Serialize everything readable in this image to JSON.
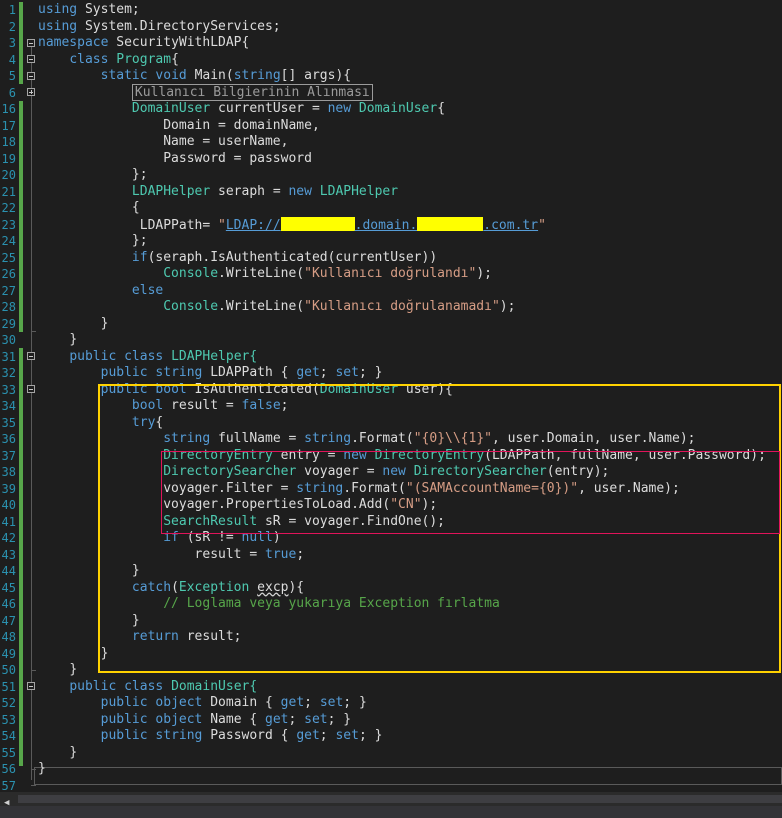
{
  "editor": {
    "line_numbers": [
      "1",
      "2",
      "3",
      "4",
      "5",
      "6",
      "16",
      "17",
      "18",
      "19",
      "20",
      "21",
      "22",
      "23",
      "24",
      "25",
      "26",
      "27",
      "28",
      "29",
      "30",
      "31",
      "32",
      "33",
      "34",
      "35",
      "36",
      "37",
      "38",
      "39",
      "40",
      "41",
      "42",
      "43",
      "44",
      "45",
      "46",
      "47",
      "48",
      "49",
      "50",
      "51",
      "52",
      "53",
      "54",
      "55",
      "56",
      "57"
    ],
    "tokens": {
      "using": "using",
      "system": "System;",
      "system_ds": "System.DirectoryServices;",
      "namespace": "namespace",
      "ns_name": "SecurityWithLDAP{",
      "class": "class",
      "program": "Program",
      "brace_open": "{",
      "static": "static",
      "void": "void",
      "main": "Main(",
      "string_kw": "string",
      "main_args": "[] args){",
      "collapsed_region": "Kullanıcı Bilgierinin Alınması",
      "domainuser": "DomainUser",
      "current_user_decl": " currentUser = ",
      "new": "new",
      "domain_assign": "Domain = domainName,",
      "name_assign": "Name = userName,",
      "password_assign": "Password = password",
      "close_semi": "};",
      "close_brace": "}",
      "ldaphelper": "LDAPHelper",
      "seraph_decl": " seraph = ",
      "ldap_path_assign": "LDAPPath= ",
      "quote": "\"",
      "ldap_url_start": "LDAP://",
      "ldap_url_mid": ".domain.",
      "ldap_url_end": ".com.tr",
      "if": "if",
      "if_cond": "(seraph.IsAuthenticated(currentUser))",
      "console": "Console",
      "writeline": ".WriteLine(",
      "msg_ok": "\"Kullanıcı doğrulandı\"",
      "paren_semi": ");",
      "else": "else",
      "msg_fail": "\"Kullanıcı doğrulanamadı\"",
      "public": "public",
      "ldaphelper_decl": "LDAPHelper{",
      "ldappath_prop": " LDAPPath { ",
      "get": "get",
      "semi_space": "; ",
      "set": "set",
      "prop_end": "; }",
      "bool": "bool",
      "is_auth": " IsAuthenticated(",
      "user_param": " user){",
      "result_decl": " result = ",
      "false": "false",
      "semi": ";",
      "try": "try",
      "fullname_decl": " fullName = ",
      "format": ".Format(",
      "fmt_domain": "\"{0}\\\\{1}\"",
      "fmt_args": ", user.Domain, user.Name);",
      "directoryentry": "DirectoryEntry",
      "entry_decl": " entry = ",
      "entry_args": "(LDAPPath, fullName, user.Password);",
      "directorysearcher": "DirectorySearcher",
      "voyager_decl": " voyager = ",
      "searcher_args": "(entry);",
      "filter_assign": "voyager.Filter = ",
      "fmt_filter": "\"(SAMAccountName={0})\"",
      "filter_args": ", user.Name);",
      "props_add": "voyager.PropertiesToLoad.Add(",
      "cn": "\"CN\"",
      "searchresult": "SearchResult",
      "sr_decl": " sR = voyager.FindOne();",
      "if_sr": " (sR != ",
      "null": "null",
      "paren_close": ")",
      "result_assign": "result = ",
      "true": "true",
      "catch": "catch",
      "paren_open": "(",
      "exception": "Exception",
      "space": " ",
      "excp": "excp",
      "catch_end": "){",
      "comment": "// Loglama veya yukarıya Exception fırlatma",
      "return": "return",
      "return_result": " result;",
      "domainuser_decl": "DomainUser{",
      "object": "object",
      "domain_prop": " Domain { ",
      "name_prop": " Name { ",
      "password_prop": " Password { "
    }
  },
  "colors": {
    "background": "#1e1e1e",
    "keyword": "#569cd6",
    "type": "#4ec9b0",
    "string": "#d69d85",
    "comment": "#57a64a",
    "line_number": "#2b91af",
    "highlight_box": "#ffd200",
    "inner_box": "#e0145a",
    "redaction": "#ffff00"
  },
  "icons": {
    "fold_expanded": "minus-box-icon",
    "fold_collapsed": "plus-box-icon",
    "scroll_left": "triangle-left-icon"
  }
}
